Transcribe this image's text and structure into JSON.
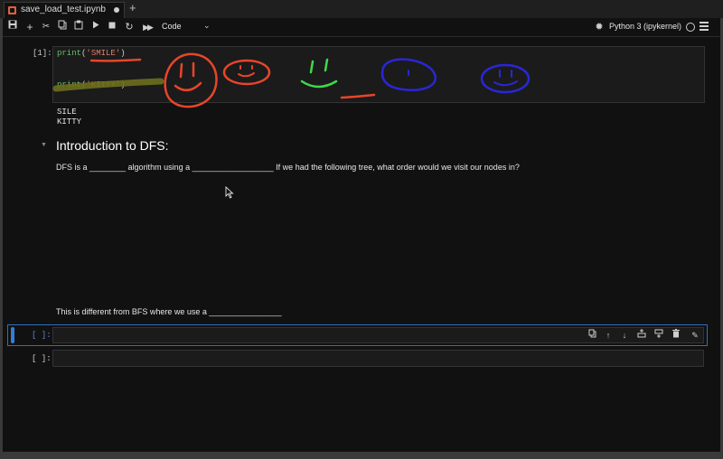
{
  "tab": {
    "title": "save_load_test.ipynb",
    "new_tab_label": "+"
  },
  "toolbar": {
    "icons": [
      "save-icon",
      "add-cell-icon",
      "cut-icon",
      "copy-icon",
      "paste-icon",
      "run-icon",
      "stop-icon",
      "restart-icon",
      "run-all-icon"
    ],
    "cell_type": "Code",
    "kernel": "Python 3 (ipykernel)"
  },
  "cells": {
    "c1": {
      "prompt": "[1]:",
      "line1": {
        "fn": "print",
        "open": "(",
        "str": "'SMILE'",
        "close": ")"
      },
      "line2": {
        "fn": "print",
        "open": "(",
        "str": "'KITTY'",
        "close": ")"
      },
      "output": [
        "SILE",
        "KITTY"
      ]
    },
    "md": {
      "heading": "Introduction to DFS:",
      "p1": "DFS is a ________ algorithm using a __________________ If we had the following tree, what order would we visit our nodes in?",
      "p2": "This is different from BFS where we use a ________________"
    },
    "c2": {
      "prompt": "[ ]:"
    },
    "c3": {
      "prompt": "[ ]:"
    }
  },
  "cell_toolbar": [
    "duplicate-icon",
    "move-up-icon",
    "move-down-icon",
    "insert-above-icon",
    "insert-below-icon",
    "delete-icon",
    "edit-icon"
  ],
  "annotation_colors": {
    "red": "#e8452b",
    "green": "#3fd94a",
    "blue": "#2a26d6",
    "olive": "#6e6f1f"
  }
}
